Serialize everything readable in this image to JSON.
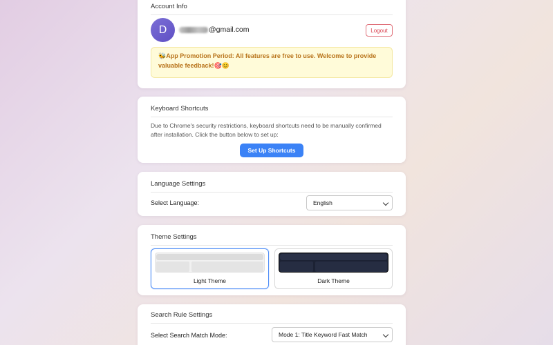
{
  "account": {
    "title": "Account Info",
    "avatar_letter": "D",
    "email_visible": "@gmail.com",
    "logout_label": "Logout",
    "promo_icon": "🐝",
    "promo_text": "App Promotion Period: All features are free to use. Welcome to provide valuable feedback!",
    "promo_emojis": "🎯😊"
  },
  "shortcuts": {
    "title": "Keyboard Shortcuts",
    "description": "Due to Chrome's security restrictions, keyboard shortcuts need to be manually confirmed after installation. Click the button below to set up:",
    "button_label": "Set Up Shortcuts"
  },
  "language": {
    "title": "Language Settings",
    "label": "Select Language:",
    "selected": "English"
  },
  "theme": {
    "title": "Theme Settings",
    "options": [
      {
        "label": "Light Theme",
        "selected": true
      },
      {
        "label": "Dark Theme",
        "selected": false
      }
    ]
  },
  "search_rule": {
    "title": "Search Rule Settings",
    "label": "Select Search Match Mode:",
    "selected": "Mode 1: Title Keyword Fast Match"
  },
  "colors": {
    "primary": "#3b82f6",
    "logout": "#d9404e",
    "promo_text": "#b8731a",
    "promo_bg": "#fffbd9",
    "avatar": "#6a5acd"
  }
}
